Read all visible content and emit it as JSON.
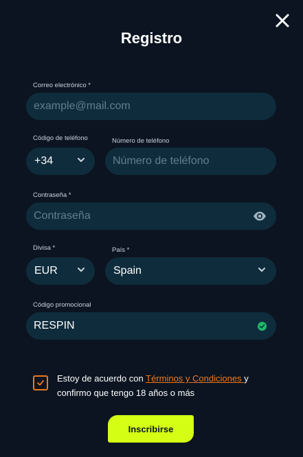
{
  "title": "Registro",
  "close_icon": "close-icon",
  "email": {
    "label": "Correo electrónico *",
    "placeholder": "example@mail.com"
  },
  "phone_code": {
    "label": "Código de teléfono",
    "value": "+34"
  },
  "phone_number": {
    "label": "Número de teléfono",
    "placeholder": "Número de teléfono"
  },
  "password": {
    "label": "Contraseña *",
    "placeholder": "Contraseña"
  },
  "currency": {
    "label": "Divisa *",
    "value": "EUR"
  },
  "country": {
    "label": "País *",
    "value": "Spain"
  },
  "promo": {
    "label": "Código promocional",
    "value": "RESPIN"
  },
  "terms": {
    "prefix": "Estoy de acuerdo con ",
    "link": "Términos y Condiciones ",
    "suffix": "y confirmo que tengo 18 años o más",
    "checked": true
  },
  "submit_label": "Inscribirse",
  "colors": {
    "background": "#0b1420",
    "field": "#0f2c3c",
    "accent_orange": "#ee7a1d",
    "button": "#d4ff14",
    "valid_green": "#1fb86a"
  }
}
